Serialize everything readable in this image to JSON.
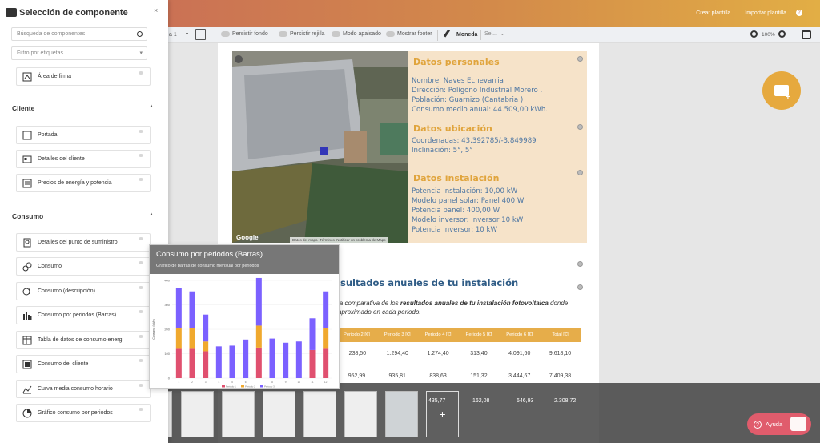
{
  "topbar": {
    "create_template": "Crear plantilla",
    "separator": "|",
    "import_template": "Importar plantilla",
    "help_icon": "question-circle-icon"
  },
  "toolbar": {
    "page_selector": "a 1",
    "toggles": [
      "Persistir fondo",
      "Persistir rejilla",
      "Modo apaisado",
      "Mostrar footer"
    ],
    "currency_label": "Moneda",
    "currency_value": "Sel...",
    "zoom": "100%"
  },
  "sidebar": {
    "title": "Selección de componente",
    "search_placeholder": "Búsqueda de componentes",
    "tag_filter_placeholder": "Filtro por etiquetas",
    "top_item": "Área de firma",
    "groups": [
      {
        "name": "Cliente",
        "items": [
          "Portada",
          "Detalles del cliente",
          "Precios de energía y potencia"
        ]
      },
      {
        "name": "Consumo",
        "items": [
          "Detalles del punto de suministro",
          "Consumo",
          "Consumo (descripción)",
          "Consumo por periodos (Barras)",
          "Tabla de datos de consumo energ",
          "Consumo del cliente",
          "Curva media consumo horario",
          "Gráfico consumo por periodos"
        ]
      }
    ]
  },
  "tooltip": {
    "title": "Consumo por periodos (Barras)",
    "subtitle": "Gráfico de barras de consumo mensual por periodos"
  },
  "chart_data": {
    "type": "bar",
    "stacked": true,
    "categories": [
      "1",
      "2",
      "3",
      "4",
      "5",
      "6",
      "7",
      "8",
      "9",
      "10",
      "11",
      "12"
    ],
    "ylabel": "Consumo (kWh)",
    "ylim": [
      0,
      400
    ],
    "yticks": [
      "0",
      "100",
      "200",
      "300",
      "400"
    ],
    "series": [
      {
        "name": "Periodo 1",
        "color": "#e0506f",
        "values": [
          120,
          120,
          110,
          0,
          0,
          0,
          125,
          0,
          0,
          0,
          115,
          120
        ]
      },
      {
        "name": "Periodo 2",
        "color": "#f0a92e",
        "values": [
          85,
          85,
          40,
          0,
          0,
          0,
          90,
          0,
          0,
          0,
          0,
          85
        ]
      },
      {
        "name": "Periodo 3",
        "color": "#7b61ff",
        "values": [
          165,
          150,
          110,
          130,
          133,
          158,
          195,
          162,
          145,
          150,
          130,
          150
        ]
      }
    ]
  },
  "map": {
    "google_label": "Google",
    "footer": [
      "Datos del mapa",
      "Términos",
      "Notificar un problema de Maps"
    ]
  },
  "personal": {
    "title": "Datos personales",
    "name": "Nombre: Naves Echevarria",
    "address": "Dirección: Polígono Industrial Morero .",
    "population": "Población: Guarnizo  (Cantabria )",
    "consumption": "Consumo medio anual: 44.509,00 kWh."
  },
  "location": {
    "title": "Datos ubicación",
    "coords": "Coordenadas:  43.392785/-3.849989",
    "incline": "Inclinación:  5°, 5°"
  },
  "installation": {
    "title": "Datos instalación",
    "power": "Potencia instalación:  10,00 kW",
    "panel_model": "Modelo panel solar:  Panel 400 W",
    "panel_power": "Potencia panel:  400,00 W",
    "inverter_model": "Modelo inversor:  Inversor 10 kW",
    "inverter_power": "Potencia inversor:  10 kW"
  },
  "results": {
    "title": "sultados anuales de tu instalación",
    "text_1": "la comparativa de los ",
    "text_bold": "resultados anuales de tu instalación fotovoltaica",
    "text_2": " donde",
    "text_3": "aproximado en cada periodo.",
    "headers": [
      "Periodo 2 [€]",
      "Periodo 3 [€]",
      "Periodo 4 [€]",
      "Periodo 5 [€]",
      "Periodo 6 [€]",
      "Total [€]"
    ],
    "rows": [
      [
        ".238,50",
        "1.294,40",
        "1.274,40",
        "313,40",
        "4.091,60",
        "9.618,10"
      ],
      [
        "952,99",
        "935,81",
        "838,63",
        "151,32",
        "3.444,67",
        "7.409,38"
      ]
    ],
    "bottom_row": [
      "435,77",
      "162,08",
      "646,93",
      "2.308,72"
    ]
  },
  "help_button": "Ayuda"
}
